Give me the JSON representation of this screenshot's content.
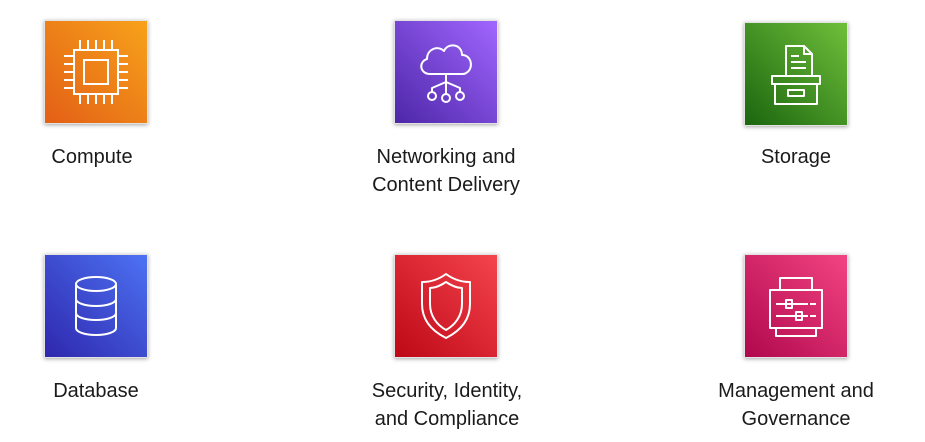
{
  "categories": [
    {
      "key": "compute",
      "icon": "cpu-chip-icon",
      "label_lines": [
        "Compute"
      ],
      "color_from": "#f7a21b",
      "color_to": "#e35f16"
    },
    {
      "key": "networking",
      "icon": "cloud-network-icon",
      "label_lines": [
        "Networking and",
        "Content Delivery"
      ],
      "color_from": "#a166ff",
      "color_to": "#4d27a8"
    },
    {
      "key": "storage",
      "icon": "storage-archive-icon",
      "label_lines": [
        "Storage"
      ],
      "color_from": "#6fbf3a",
      "color_to": "#1b660f"
    },
    {
      "key": "database",
      "icon": "database-cylinder-icon",
      "label_lines": [
        "Database"
      ],
      "color_from": "#4d72f3",
      "color_to": "#2e27ad"
    },
    {
      "key": "security",
      "icon": "shield-icon",
      "label_lines": [
        "Security, Identity,",
        "and Compliance"
      ],
      "color_from": "#f5444e",
      "color_to": "#bd0816"
    },
    {
      "key": "management",
      "icon": "clipboard-sliders-icon",
      "label_lines": [
        "Management and",
        "Governance"
      ],
      "color_from": "#f34482",
      "color_to": "#b0084d"
    }
  ]
}
